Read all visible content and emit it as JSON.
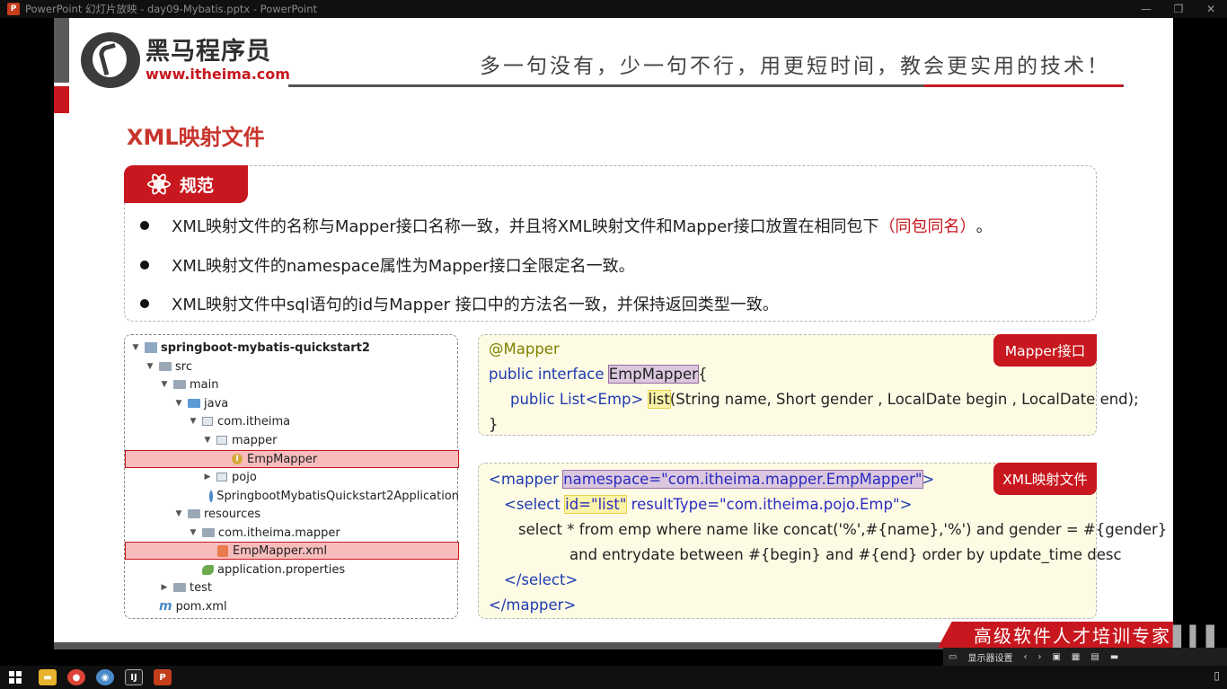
{
  "window": {
    "title": "PowerPoint 幻灯片放映  -  day09-Mybatis.pptx  -  PowerPoint",
    "app_icon": "P",
    "controls": [
      "minimize",
      "restore",
      "close"
    ]
  },
  "slide": {
    "logo": {
      "cn": "黑马程序员",
      "url": "www.itheima.com"
    },
    "motto": "多一句没有，少一句不行，用更短时间，教会更实用的技术！",
    "heading": "XML映射文件",
    "spec": {
      "tab_label": "规范",
      "bullets": [
        {
          "text": "XML映射文件的名称与Mapper接口名称一致，并且将XML映射文件和Mapper接口放置在相同包下",
          "highlight": "（同包同名）",
          "tail": "。"
        },
        {
          "text": "XML映射文件的namespace属性为Mapper接口全限定名一致。"
        },
        {
          "text": "XML映射文件中sql语句的id与Mapper 接口中的方法名一致，并保持返回类型一致。"
        }
      ]
    },
    "tree": [
      {
        "label": "springboot-mybatis-quickstart2",
        "icon": "module-icon",
        "arrow": "▼"
      },
      {
        "label": "src",
        "icon": "folder-icon",
        "arrow": "▼"
      },
      {
        "label": "main",
        "icon": "folder-icon",
        "arrow": "▼"
      },
      {
        "label": "java",
        "icon": "source-folder-icon",
        "arrow": "▼"
      },
      {
        "label": "com.itheima",
        "icon": "package-icon",
        "arrow": "▼"
      },
      {
        "label": "mapper",
        "icon": "package-icon",
        "arrow": "▼"
      },
      {
        "label": "EmpMapper",
        "icon": "interface-icon",
        "arrow": "",
        "highlighted": true
      },
      {
        "label": "pojo",
        "icon": "package-icon",
        "arrow": "▶"
      },
      {
        "label": "SpringbootMybatisQuickstart2Application",
        "icon": "class-icon",
        "arrow": ""
      },
      {
        "label": "resources",
        "icon": "resources-folder-icon",
        "arrow": "▼"
      },
      {
        "label": "com.itheima.mapper",
        "icon": "folder-icon",
        "arrow": "▼"
      },
      {
        "label": "EmpMapper.xml",
        "icon": "xml-file-icon",
        "arrow": "",
        "highlighted": true
      },
      {
        "label": "application.properties",
        "icon": "properties-file-icon",
        "arrow": ""
      },
      {
        "label": "test",
        "icon": "folder-icon",
        "arrow": "▶"
      },
      {
        "label": "pom.xml",
        "icon": "maven-icon",
        "arrow": ""
      }
    ],
    "mapper_code": {
      "tag": "Mapper接口",
      "annotation": "@Mapper",
      "decl_prefix": "public interface ",
      "decl_name": "EmpMapper",
      "decl_brace": "{",
      "method_prefix": "public List<Emp> ",
      "method_name": "list",
      "method_params": "(String name, Short gender , LocalDate begin , LocalDate end);",
      "close": "}"
    },
    "xml_code": {
      "tag": "XML映射文件",
      "open_tag": "<mapper ",
      "ns_attr": "namespace=\"com.itheima.mapper.EmpMapper\"",
      "open_end": ">",
      "select_open": "<select ",
      "select_id": "id=\"list\"",
      "select_result": " resultType=\"com.itheima.pojo.Emp\"",
      "select_open_end": ">",
      "sql_1": "select * from emp where name like concat('%',#{name},'%') and gender = #{gender}",
      "sql_2": "and entrydate between #{begin} and #{end} order by update_time desc",
      "select_close": "</select>",
      "close_tag": "</mapper>"
    },
    "banner": "高级软件人才培训专家"
  },
  "slideshow_bar": {
    "display_settings": "显示器设置"
  },
  "taskbar": {
    "apps": [
      "file-explorer",
      "chrome",
      "app",
      "intellij-idea",
      "powerpoint"
    ]
  }
}
